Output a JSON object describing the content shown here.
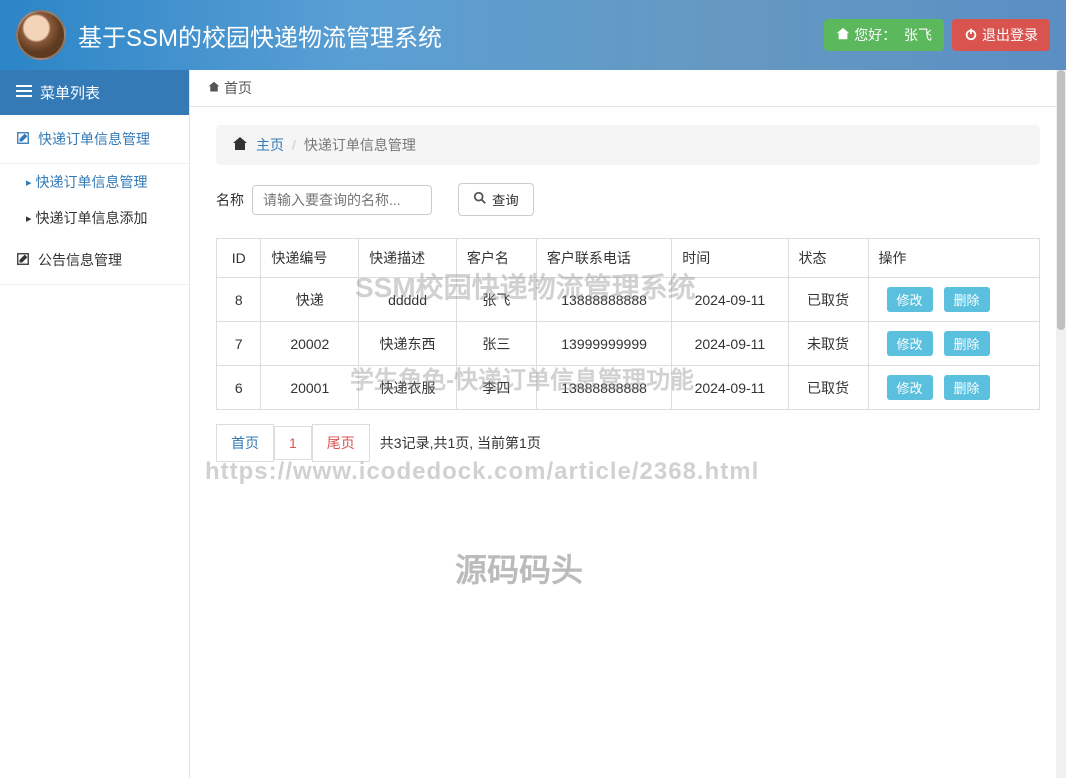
{
  "header": {
    "title": "基于SSM的校园快递物流管理系统",
    "greeting_prefix": "您好：",
    "user_name": "张飞",
    "logout_label": "退出登录"
  },
  "sidebar": {
    "header": "菜单列表",
    "groups": [
      {
        "label": "快递订单信息管理",
        "items": [
          {
            "label": "快递订单信息管理",
            "active": true
          },
          {
            "label": "快递订单信息添加",
            "active": false
          }
        ]
      },
      {
        "label": "公告信息管理"
      }
    ]
  },
  "topbar": {
    "home_label": "首页"
  },
  "breadcrumb": {
    "home": "主页",
    "current": "快递订单信息管理"
  },
  "search": {
    "label": "名称",
    "placeholder": "请输入要查询的名称...",
    "button": "查询"
  },
  "table": {
    "columns": [
      "ID",
      "快递编号",
      "快递描述",
      "客户名",
      "客户联系电话",
      "时间",
      "状态",
      "操作"
    ],
    "rows": [
      {
        "id": "8",
        "code": "快递",
        "desc": "ddddd",
        "customer": "张飞",
        "phone": "13888888888",
        "time": "2024-09-11",
        "status": "已取货"
      },
      {
        "id": "7",
        "code": "20002",
        "desc": "快递东西",
        "customer": "张三",
        "phone": "13999999999",
        "time": "2024-09-11",
        "status": "未取货"
      },
      {
        "id": "6",
        "code": "20001",
        "desc": "快递衣服",
        "customer": "李四",
        "phone": "13888888888",
        "time": "2024-09-11",
        "status": "已取货"
      }
    ],
    "action_edit": "修改",
    "action_delete": "删除"
  },
  "pager": {
    "first": "首页",
    "page": "1",
    "last": "尾页",
    "info": "共3记录,共1页, 当前第1页"
  },
  "watermarks": {
    "w1": "SSM校园快递物流管理系统",
    "w2": "学生角色-快递订单信息管理功能",
    "w3": "https://www.icodedock.com/article/2368.html",
    "w4": "源码码头"
  }
}
